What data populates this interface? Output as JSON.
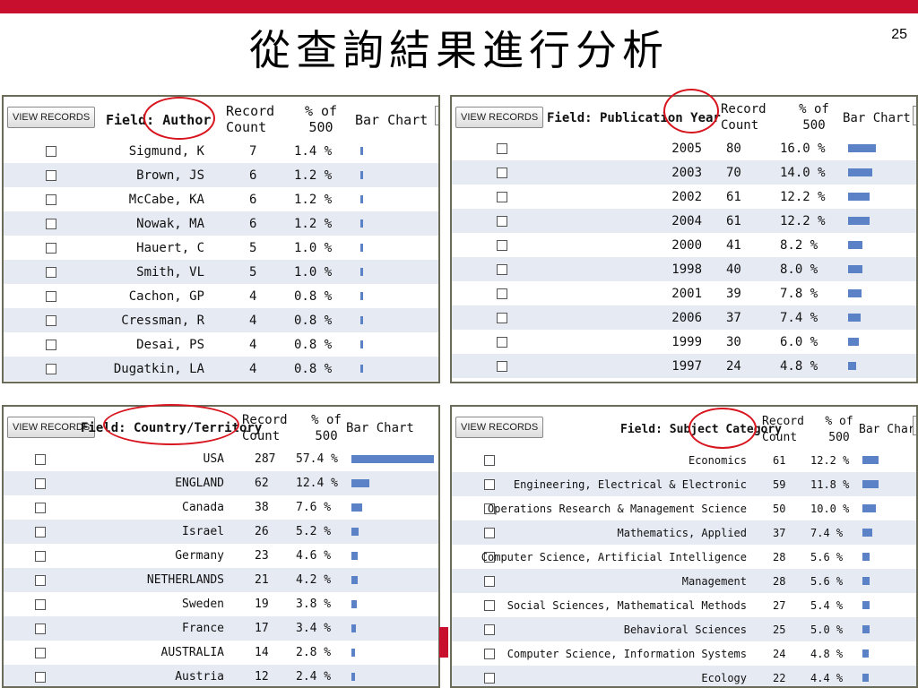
{
  "slide": {
    "title": "從查詢結果進行分析",
    "page_number": "25",
    "accent_color": "#c8102e"
  },
  "view_records_label": "VIEW RECORDS",
  "bar_color": "#5b82c7",
  "panels": [
    {
      "field_label": "Field: Author",
      "headers": {
        "count": "Record Count",
        "pct": "% of 500",
        "bar": "Bar Chart"
      },
      "rows": [
        {
          "label": "Sigmund, K",
          "count": "7",
          "pct": "1.4 %",
          "value": 1.4
        },
        {
          "label": "Brown, JS",
          "count": "6",
          "pct": "1.2 %",
          "value": 1.2
        },
        {
          "label": "McCabe, KA",
          "count": "6",
          "pct": "1.2 %",
          "value": 1.2
        },
        {
          "label": "Nowak, MA",
          "count": "6",
          "pct": "1.2 %",
          "value": 1.2
        },
        {
          "label": "Hauert, C",
          "count": "5",
          "pct": "1.0 %",
          "value": 1.0
        },
        {
          "label": "Smith, VL",
          "count": "5",
          "pct": "1.0 %",
          "value": 1.0
        },
        {
          "label": "Cachon, GP",
          "count": "4",
          "pct": "0.8 %",
          "value": 0.8
        },
        {
          "label": "Cressman, R",
          "count": "4",
          "pct": "0.8 %",
          "value": 0.8
        },
        {
          "label": "Desai, PS",
          "count": "4",
          "pct": "0.8 %",
          "value": 0.8
        },
        {
          "label": "Dugatkin, LA",
          "count": "4",
          "pct": "0.8 %",
          "value": 0.8
        }
      ]
    },
    {
      "field_label": "Field: Publication Year",
      "headers": {
        "count": "Record Count",
        "pct": "% of 500",
        "bar": "Bar Chart"
      },
      "rows": [
        {
          "label": "2005",
          "count": "80",
          "pct": "16.0 %",
          "value": 16.0
        },
        {
          "label": "2003",
          "count": "70",
          "pct": "14.0 %",
          "value": 14.0
        },
        {
          "label": "2002",
          "count": "61",
          "pct": "12.2 %",
          "value": 12.2
        },
        {
          "label": "2004",
          "count": "61",
          "pct": "12.2 %",
          "value": 12.2
        },
        {
          "label": "2000",
          "count": "41",
          "pct": "8.2 %",
          "value": 8.2
        },
        {
          "label": "1998",
          "count": "40",
          "pct": "8.0 %",
          "value": 8.0
        },
        {
          "label": "2001",
          "count": "39",
          "pct": "7.8 %",
          "value": 7.8
        },
        {
          "label": "2006",
          "count": "37",
          "pct": "7.4 %",
          "value": 7.4
        },
        {
          "label": "1999",
          "count": "30",
          "pct": "6.0 %",
          "value": 6.0
        },
        {
          "label": "1997",
          "count": "24",
          "pct": "4.8 %",
          "value": 4.8
        }
      ]
    },
    {
      "field_label": "Field: Country/Territory",
      "headers": {
        "count": "Record Count",
        "pct": "% of 500",
        "bar": "Bar Chart"
      },
      "rows": [
        {
          "label": "USA",
          "count": "287",
          "pct": "57.4 %",
          "value": 57.4
        },
        {
          "label": "ENGLAND",
          "count": "62",
          "pct": "12.4 %",
          "value": 12.4
        },
        {
          "label": "Canada",
          "count": "38",
          "pct": "7.6 %",
          "value": 7.6
        },
        {
          "label": "Israel",
          "count": "26",
          "pct": "5.2 %",
          "value": 5.2
        },
        {
          "label": "Germany",
          "count": "23",
          "pct": "4.6 %",
          "value": 4.6
        },
        {
          "label": "NETHERLANDS",
          "count": "21",
          "pct": "4.2 %",
          "value": 4.2
        },
        {
          "label": "Sweden",
          "count": "19",
          "pct": "3.8 %",
          "value": 3.8
        },
        {
          "label": "France",
          "count": "17",
          "pct": "3.4 %",
          "value": 3.4
        },
        {
          "label": "AUSTRALIA",
          "count": "14",
          "pct": "2.8 %",
          "value": 2.8
        },
        {
          "label": "Austria",
          "count": "12",
          "pct": "2.4 %",
          "value": 2.4
        }
      ]
    },
    {
      "field_label": "Field: Subject Category",
      "headers": {
        "count": "Record Count",
        "pct": "% of 500",
        "bar": "Bar Chart"
      },
      "rows": [
        {
          "label": "Economics",
          "count": "61",
          "pct": "12.2 %",
          "value": 12.2
        },
        {
          "label": "Engineering, Electrical & Electronic",
          "count": "59",
          "pct": "11.8 %",
          "value": 11.8
        },
        {
          "label": "Operations Research & Management Science",
          "count": "50",
          "pct": "10.0 %",
          "value": 10.0
        },
        {
          "label": "Mathematics, Applied",
          "count": "37",
          "pct": "7.4 %",
          "value": 7.4
        },
        {
          "label": "Computer Science, Artificial Intelligence",
          "count": "28",
          "pct": "5.6 %",
          "value": 5.6
        },
        {
          "label": "Management",
          "count": "28",
          "pct": "5.6 %",
          "value": 5.6
        },
        {
          "label": "Social Sciences, Mathematical Methods",
          "count": "27",
          "pct": "5.4 %",
          "value": 5.4
        },
        {
          "label": "Behavioral Sciences",
          "count": "25",
          "pct": "5.0 %",
          "value": 5.0
        },
        {
          "label": "Computer Science, Information Systems",
          "count": "24",
          "pct": "4.8 %",
          "value": 4.8
        },
        {
          "label": "Ecology",
          "count": "22",
          "pct": "4.4 %",
          "value": 4.4
        }
      ]
    }
  ]
}
